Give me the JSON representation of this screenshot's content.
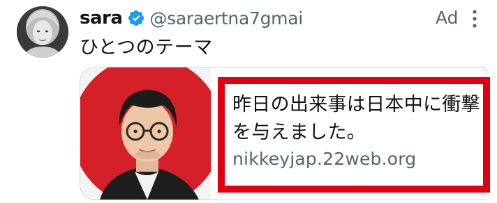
{
  "author": {
    "name": "sara",
    "handle": "@saraertna7gmai"
  },
  "ad_label": "Ad",
  "tweet_text": "ひとつのテーマ",
  "card": {
    "title": "昨日の出来事は日本中に衝撃を与えました。",
    "domain": "nikkeyjap.22web.org"
  },
  "icons": {
    "verified": "verified-badge-icon",
    "more": "more-options-icon"
  },
  "colors": {
    "verified": "#1d9bf0",
    "highlight": "#e00012",
    "secondary_text": "#536471",
    "flag_red": "#d5202a"
  }
}
